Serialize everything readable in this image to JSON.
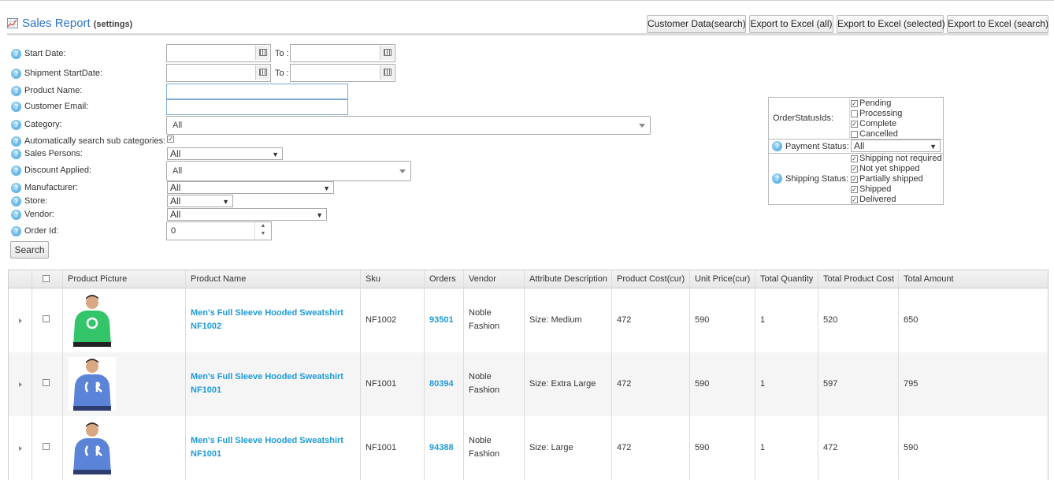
{
  "header": {
    "title": "Sales Report",
    "subtitle": "(settings)",
    "buttons": [
      "Customer Data(search)",
      "Export to Excel (all)",
      "Export to Excel (selected)",
      "Export to Excel (search)"
    ]
  },
  "filters": {
    "start_date_label": "Start Date:",
    "shipment_start_label": "Shipment StartDate:",
    "to_label": "To :",
    "start_date_value": "",
    "end_date_value": "",
    "ship_start_value": "",
    "ship_end_value": "",
    "product_name_label": "Product Name:",
    "product_name_value": "",
    "customer_email_label": "Customer Email:",
    "customer_email_value": "",
    "category_label": "Category:",
    "category_value": "All",
    "auto_sub_label": "Automatically search sub categories:",
    "auto_sub_checked": true,
    "sales_persons_label": "Sales Persons:",
    "sales_persons_value": "All",
    "discount_label": "Discount Applied:",
    "discount_value": "All",
    "manufacturer_label": "Manufacturer:",
    "manufacturer_value": "All",
    "store_label": "Store:",
    "store_value": "All",
    "vendor_label": "Vendor:",
    "vendor_value": "All",
    "order_id_label": "Order Id:",
    "order_id_value": "0",
    "search_button": "Search"
  },
  "status_panel": {
    "order_status_label": "OrderStatusIds:",
    "order_statuses": [
      {
        "label": "Pending",
        "checked": true
      },
      {
        "label": "Processing",
        "checked": false
      },
      {
        "label": "Complete",
        "checked": true
      },
      {
        "label": "Cancelled",
        "checked": false
      }
    ],
    "payment_status_label": "Payment Status:",
    "payment_status_value": "All",
    "shipping_status_label": "Shipping Status:",
    "shipping_statuses": [
      {
        "label": "Shipping not required",
        "checked": true
      },
      {
        "label": "Not yet shipped",
        "checked": true
      },
      {
        "label": "Partially shipped",
        "checked": true
      },
      {
        "label": "Shipped",
        "checked": true
      },
      {
        "label": "Delivered",
        "checked": true
      }
    ]
  },
  "grid": {
    "columns": [
      "Product Picture",
      "Product Name",
      "Sku",
      "Orders",
      "Vendor",
      "Attribute Description",
      "Product Cost(cur)",
      "Unit Price(cur)",
      "Total Quantity",
      "Total Product Cost",
      "Total Amount"
    ],
    "rows": [
      {
        "name_line1": "Men's Full Sleeve Hooded Sweatshirt",
        "name_line2": "NF1002",
        "sku": "NF1002",
        "orders": "93501",
        "vendor_line1": "Noble",
        "vendor_line2": "Fashion",
        "attribute": "Size: Medium",
        "product_cost": "472",
        "unit_price": "590",
        "quantity": "1",
        "total_product_cost": "520",
        "total_amount": "650",
        "shirt_color": "#34c56a"
      },
      {
        "name_line1": "Men's Full Sleeve Hooded Sweatshirt",
        "name_line2": "NF1001",
        "sku": "NF1001",
        "orders": "80394",
        "vendor_line1": "Noble",
        "vendor_line2": "Fashion",
        "attribute": "Size: Extra Large",
        "product_cost": "472",
        "unit_price": "590",
        "quantity": "1",
        "total_product_cost": "597",
        "total_amount": "795",
        "shirt_color": "#5b84d8"
      },
      {
        "name_line1": "Men's Full Sleeve Hooded Sweatshirt",
        "name_line2": "NF1001",
        "sku": "NF1001",
        "orders": "94388",
        "vendor_line1": "Noble",
        "vendor_line2": "Fashion",
        "attribute": "Size: Large",
        "product_cost": "472",
        "unit_price": "590",
        "quantity": "1",
        "total_product_cost": "472",
        "total_amount": "590",
        "shirt_color": "#5b84d8"
      }
    ]
  },
  "colors": {
    "link": "#1e9bd7",
    "title": "#2a73c6",
    "help_icon": "#3ea0e0"
  }
}
